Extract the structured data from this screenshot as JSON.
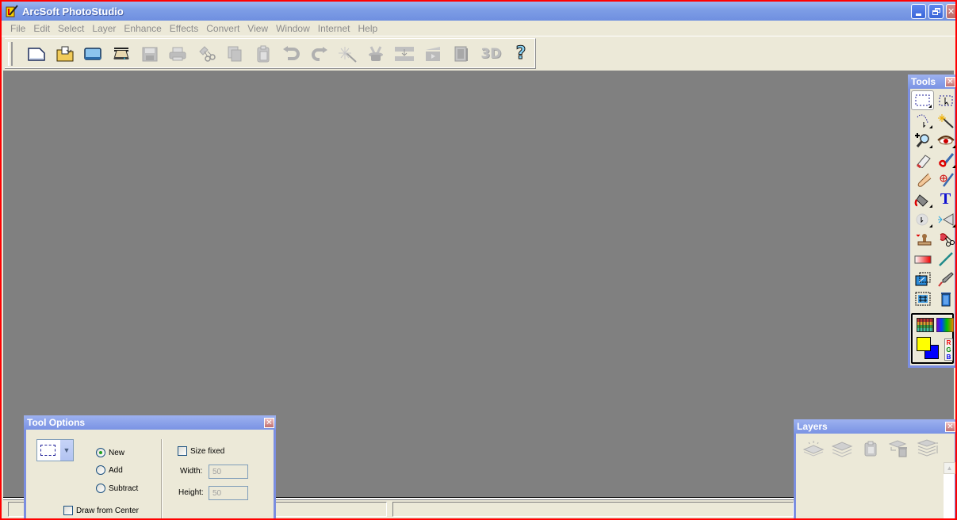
{
  "window": {
    "title": "ArcSoft PhotoStudio",
    "buttons": [
      "minimize",
      "restore",
      "close"
    ]
  },
  "menubar": {
    "items": [
      "File",
      "Edit",
      "Select",
      "Layer",
      "Enhance",
      "Effects",
      "Convert",
      "View",
      "Window",
      "Internet",
      "Help"
    ]
  },
  "toolbar": {
    "buttons": [
      {
        "icon": "new-file-icon",
        "enabled": true
      },
      {
        "icon": "open-folder-icon",
        "enabled": true
      },
      {
        "icon": "album-icon",
        "enabled": true
      },
      {
        "icon": "scanner-icon",
        "enabled": true
      },
      {
        "icon": "save-icon",
        "enabled": false
      },
      {
        "icon": "print-icon",
        "enabled": false
      },
      {
        "icon": "cut-icon",
        "enabled": false
      },
      {
        "icon": "copy-icon",
        "enabled": false
      },
      {
        "icon": "paste-icon",
        "enabled": false
      },
      {
        "icon": "undo-icon",
        "enabled": false
      },
      {
        "icon": "redo-icon",
        "enabled": false
      },
      {
        "icon": "magic-wand-icon",
        "enabled": false
      },
      {
        "icon": "magic-hat-icon",
        "enabled": false
      },
      {
        "icon": "resize-icon",
        "enabled": false
      },
      {
        "icon": "slideshow-icon",
        "enabled": false
      },
      {
        "icon": "frame-icon",
        "enabled": false
      },
      {
        "icon": "3d-icon",
        "enabled": false
      },
      {
        "icon": "help-icon",
        "enabled": true
      }
    ]
  },
  "tools_panel": {
    "title": "Tools",
    "tools": [
      "rectangle-select-icon",
      "move-selection-icon",
      "lasso-icon",
      "magic-wand-icon",
      "zoom-icon",
      "red-eye-icon",
      "eraser-icon",
      "brush-icon",
      "smudge-icon",
      "clone-icon",
      "fill-bucket-icon",
      "text-icon",
      "dodge-burn-icon",
      "sharpen-icon",
      "stamp-icon",
      "cutout-icon",
      "gradient-icon",
      "line-icon",
      "transform-icon",
      "eyedropper-icon",
      "crop-icon",
      "trash-icon"
    ],
    "colors": {
      "foreground": "#ffff00",
      "background": "#0000ff",
      "rgb_label": [
        "R",
        "G",
        "B"
      ]
    }
  },
  "tool_options": {
    "title": "Tool Options",
    "modes": [
      {
        "label": "New",
        "checked": true
      },
      {
        "label": "Add",
        "checked": false
      },
      {
        "label": "Subtract",
        "checked": false
      }
    ],
    "draw_from_center": "Draw from Center",
    "size_fixed": "Size fixed",
    "width_label": "Width:",
    "width_value": "50",
    "height_label": "Height:",
    "height_value": "50"
  },
  "layers_panel": {
    "title": "Layers",
    "buttons": [
      "new-layer-icon",
      "merge-layers-icon",
      "paste-layer-icon",
      "delete-layer-icon",
      "layer-properties-icon"
    ]
  },
  "statusbar": {
    "panes": [
      "",
      "",
      ""
    ]
  }
}
